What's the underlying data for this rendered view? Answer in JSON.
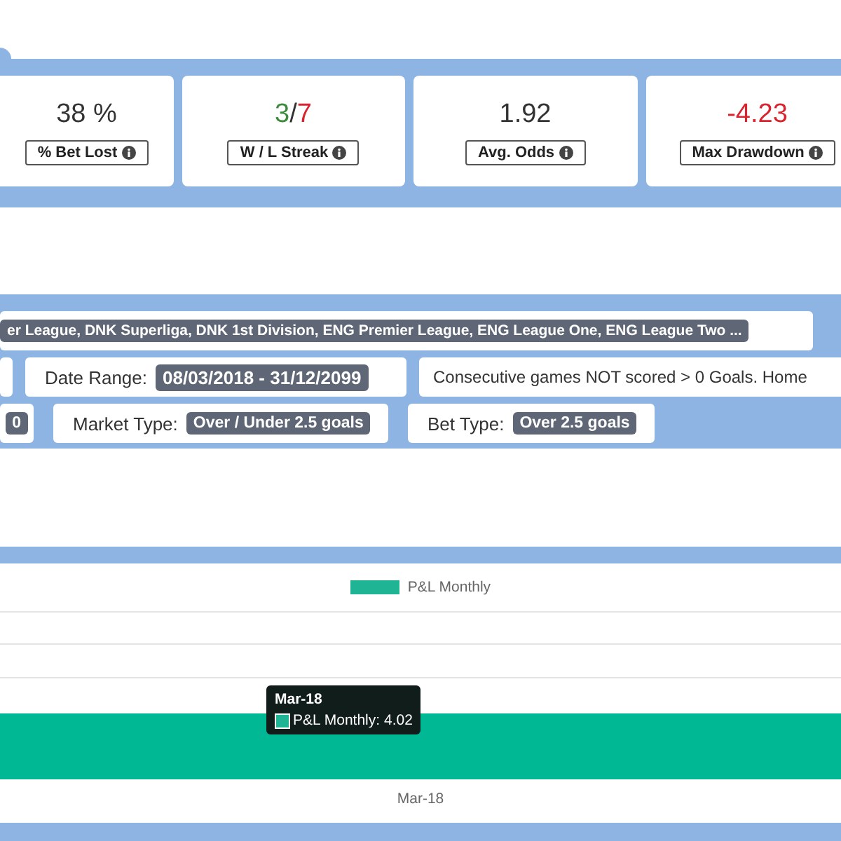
{
  "stats": [
    {
      "value_parts": [
        {
          "text": "38 %",
          "color": "#333333"
        }
      ],
      "label": "% Bet Lost"
    },
    {
      "value_parts": [
        {
          "text": "3",
          "color": "#3c8a3c"
        },
        {
          "text": "/",
          "color": "#333333"
        },
        {
          "text": "7",
          "color": "#d9232e"
        }
      ],
      "label": "W / L Streak"
    },
    {
      "value_parts": [
        {
          "text": "1.92",
          "color": "#333333"
        }
      ],
      "label": "Avg. Odds"
    },
    {
      "value_parts": [
        {
          "text": "-4.23",
          "color": "#d9232e"
        }
      ],
      "label": "Max Drawdown"
    }
  ],
  "filters": [
    [
      {
        "kind": "badge",
        "badge": "er League, DNK Superliga, DNK 1st Division, ENG Premier League, ENG League One, ENG League Two ..."
      }
    ],
    [
      {
        "kind": "blank"
      },
      {
        "kind": "labeled",
        "label": "Date Range:",
        "badge": "08/03/2018 - 31/12/2099"
      },
      {
        "kind": "text",
        "text": "Consecutive games NOT scored > 0 Goals. Home"
      }
    ],
    [
      {
        "kind": "badge",
        "badge": "0"
      },
      {
        "kind": "labeled",
        "label": "Market Type:",
        "badge": "Over / Under 2.5 goals"
      },
      {
        "kind": "labeled",
        "label": "Bet Type:",
        "badge": "Over 2.5 goals"
      }
    ]
  ],
  "chart": {
    "legend": "P&L Monthly",
    "x_label": "Mar-18",
    "tooltip": {
      "title": "Mar-18",
      "text": "P&L Monthly: 4.02"
    }
  }
}
